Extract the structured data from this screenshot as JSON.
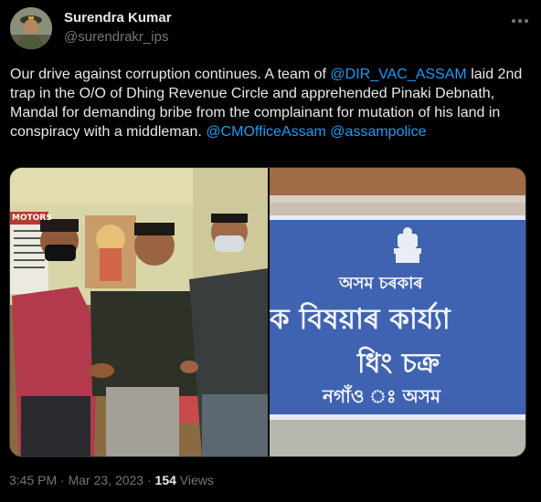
{
  "author": {
    "name": "Surendra Kumar",
    "handle": "@surendrakr_ips"
  },
  "tweet": {
    "segments": [
      {
        "text": "Our drive against corruption continues. A team of ",
        "mention": false
      },
      {
        "text": "@DIR_VAC_ASSAM",
        "mention": true
      },
      {
        "text": " laid 2nd trap in the O/O of Dhing Revenue Circle and  apprehended Pinaki Debnath, Mandal for demanding bribe from the complainant for mutation of his land in conspiracy with a middleman. ",
        "mention": false
      },
      {
        "text": "@CMOfficeAssam",
        "mention": true
      },
      {
        "text": " ",
        "mention": false
      },
      {
        "text": "@assampolice",
        "mention": true
      }
    ]
  },
  "media": {
    "left_photo": {
      "calendar_text": "MOTORS"
    },
    "right_photo": {
      "sign_line1": "অসম চৰকাৰ",
      "sign_line2": "ক বিষয়াৰ কাৰ্য্যা",
      "sign_line3": "ধিং চক্ৰ",
      "sign_line4": "নগাঁও ঃ অসম"
    }
  },
  "meta": {
    "time": "3:45 PM",
    "sep1": " · ",
    "date": "Mar 23, 2023",
    "sep2": " · ",
    "views": "154",
    "views_label": " Views"
  },
  "colors": {
    "background": "#000000",
    "text": "#e7e9ea",
    "secondary": "#71767b",
    "link": "#1d9bf0",
    "sign_blue": "#3f63b0"
  },
  "icons": {
    "more": "more-horizontal-icon"
  }
}
